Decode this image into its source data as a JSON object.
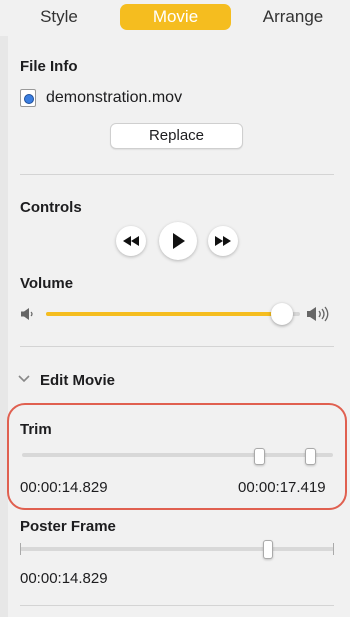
{
  "tabs": [
    {
      "label": "Style",
      "active": false
    },
    {
      "label": "Movie",
      "active": true
    },
    {
      "label": "Arrange",
      "active": false
    }
  ],
  "file_info": {
    "title": "File Info",
    "file_name": "demonstration.mov",
    "file_icon": "movie-file-icon",
    "replace_label": "Replace"
  },
  "controls": {
    "title": "Controls",
    "buttons": [
      "rewind-icon",
      "play-icon",
      "fast-forward-icon"
    ]
  },
  "volume": {
    "title": "Volume",
    "level": 0.93,
    "accent": "#f5bd1f"
  },
  "edit_movie": {
    "label": "Edit Movie",
    "expanded": true
  },
  "trim": {
    "title": "Trim",
    "start_time": "00:00:14.829",
    "end_time": "00:00:17.419"
  },
  "poster_frame": {
    "title": "Poster Frame",
    "time": "00:00:14.829"
  },
  "colors": {
    "accent": "#f5bd1f",
    "highlight_outline": "#e06050"
  }
}
